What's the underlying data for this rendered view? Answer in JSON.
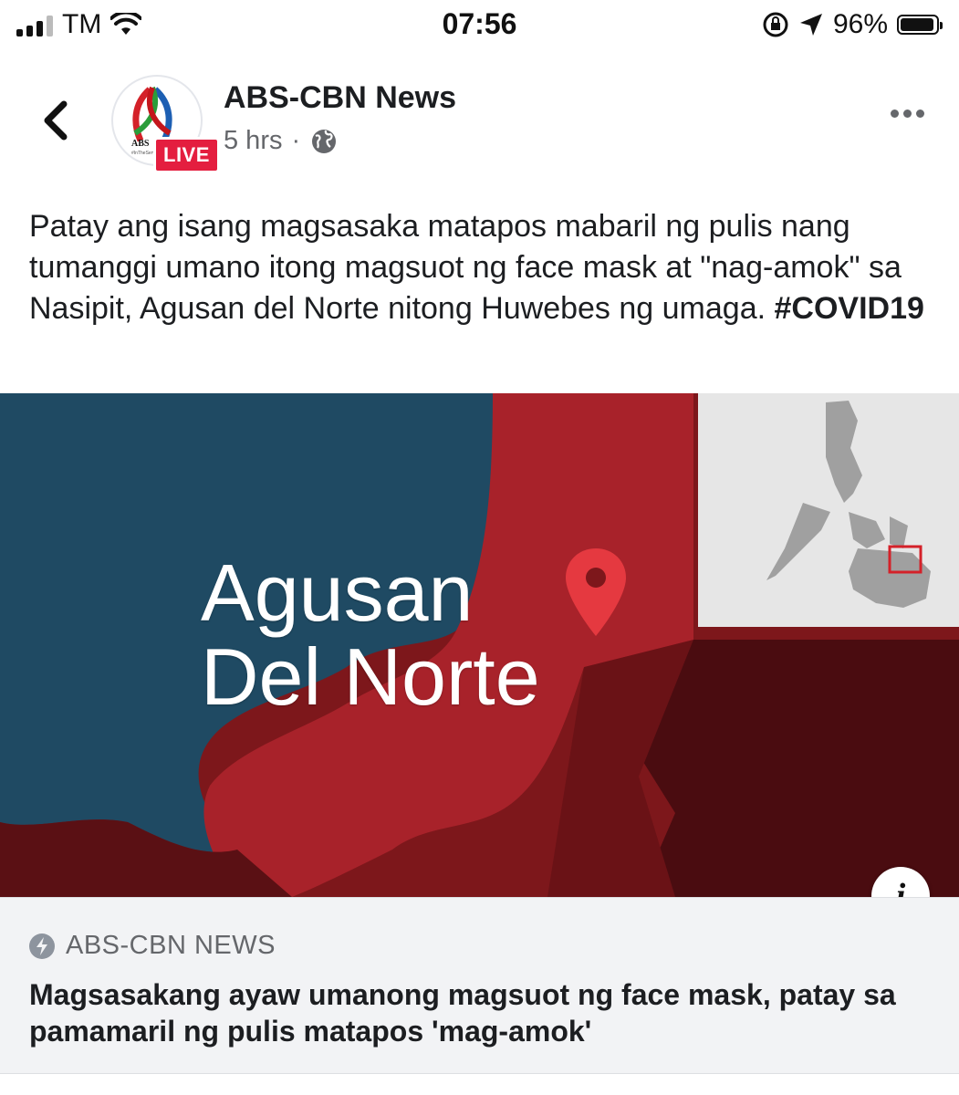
{
  "status_bar": {
    "carrier": "TM",
    "time": "07:56",
    "battery": "96%"
  },
  "post": {
    "page_name": "ABS-CBN News",
    "time_ago": "5 hrs",
    "separator": "·",
    "live_badge": "LIVE",
    "avatar_text": "ABS",
    "avatar_subtext": "#InTheServ",
    "text": "Patay ang isang magsasaka matapos mabaril ng pulis nang tumanggi umano itong magsuot ng face mask at \"nag-amok\" sa Nasipit, Agusan del Norte nitong Huwebes ng umaga.",
    "hashtag": "#COVID19"
  },
  "link_image": {
    "title_line1": "Agusan",
    "title_line2": "Del Norte",
    "info_icon": "i"
  },
  "link_preview": {
    "source": "ABS-CBN NEWS",
    "headline": "Magsasakang ayaw umanong magsuot ng face mask, patay sa pamamaril ng pulis matapos 'mag-amok'"
  },
  "colors": {
    "live_red": "#e41e3f",
    "map_blue": "#1f4a63",
    "map_red": "#8c1a1e",
    "pin_red": "#e53940",
    "preview_bg": "#f2f3f5"
  },
  "icons": [
    "signal-bars-icon",
    "wifi-icon",
    "orientation-lock-icon",
    "location-arrow-icon",
    "battery-icon",
    "back-chevron-icon",
    "globe-icon",
    "more-dots-icon",
    "map-pin-icon",
    "info-icon",
    "lightning-bolt-icon"
  ]
}
